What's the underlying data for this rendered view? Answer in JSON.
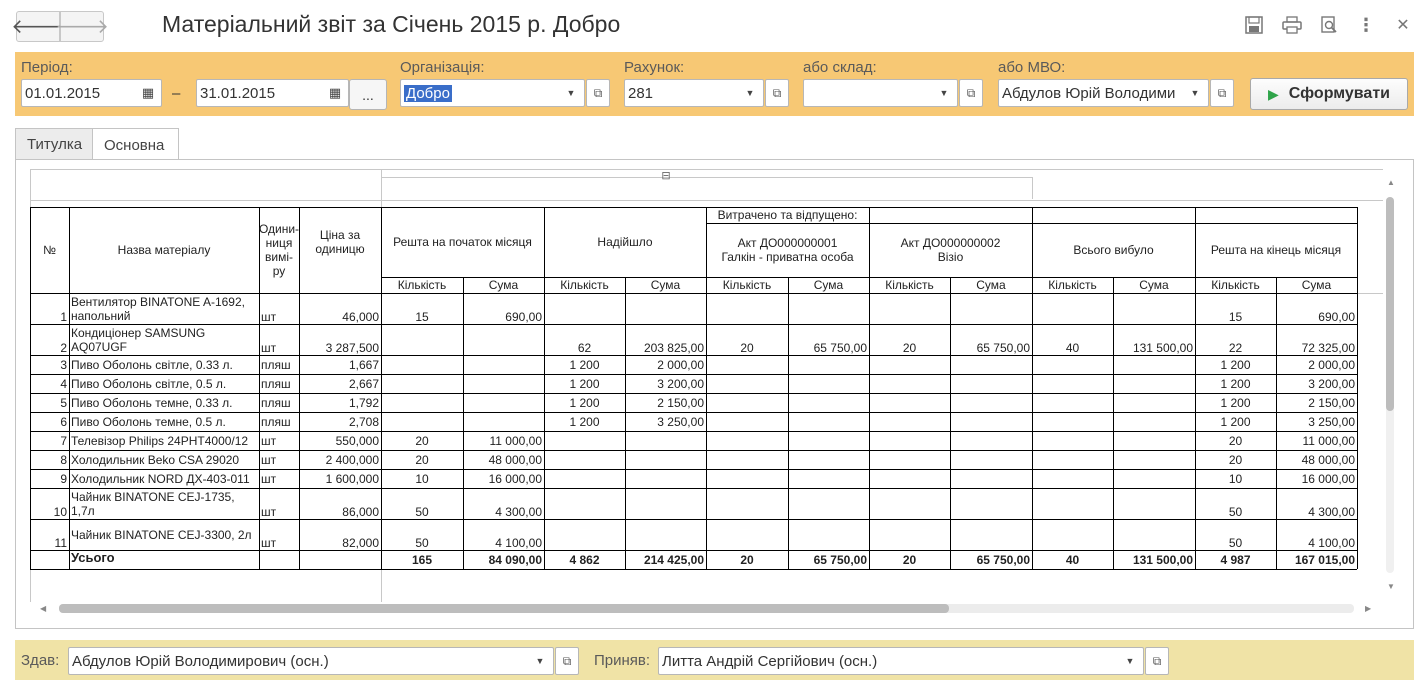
{
  "window": {
    "title": "Матеріальний звіт за Січень 2015 р. Добро"
  },
  "toolbar_icons": [
    "back-arrow",
    "forward-arrow",
    "save-icon",
    "print-icon",
    "preview-icon",
    "more-icon",
    "close-icon"
  ],
  "filters": {
    "period_label": "Період:",
    "date_from": "01.01.2015",
    "date_sep": "–",
    "date_to": "31.01.2015",
    "dots_label": "...",
    "org_label": "Організація:",
    "org_value": "Добро",
    "account_label": "Рахунок:",
    "account_value": "281",
    "warehouse_label": "або склад:",
    "warehouse_value": "",
    "mvo_label": "або МВО:",
    "mvo_value": "Абдулов Юрій Володими",
    "generate_label": "Сформувати"
  },
  "tabs": [
    {
      "label": "Титулка",
      "active": false
    },
    {
      "label": "Основна",
      "active": true
    }
  ],
  "report": {
    "headers": {
      "num": "№",
      "name": "Назва матеріалу",
      "unit": "Одини-\nниця\nвимі-\nру",
      "price": "Ціна за одиницю",
      "start": "Решта на початок місяця",
      "received": "Надійшло",
      "spent": "Витрачено та відпущено:",
      "act1": "Акт ДО000000001\nГалкін - приватна особа",
      "act2": "Акт ДО000000002\nВізіо",
      "total_out": "Всього вибуло",
      "end": "Решта на кінець місяця",
      "qty": "Кількість",
      "sum": "Сума"
    },
    "rows": [
      {
        "n": "1",
        "name": "Вентилятор BINATONE A-1692, напольний",
        "unit": "шт",
        "price": "46,000",
        "sq": "15",
        "ss": "690,00",
        "rq": "",
        "rs": "",
        "a1q": "",
        "a1s": "",
        "a2q": "",
        "a2s": "",
        "tq": "",
        "ts": "",
        "eq": "15",
        "es": "690,00"
      },
      {
        "n": "2",
        "name": "Кондиціонер SAMSUNG AQ07UGF",
        "unit": "шт",
        "price": "3 287,500",
        "sq": "",
        "ss": "",
        "rq": "62",
        "rs": "203 825,00",
        "a1q": "20",
        "a1s": "65 750,00",
        "a2q": "20",
        "a2s": "65 750,00",
        "tq": "40",
        "ts": "131 500,00",
        "eq": "22",
        "es": "72 325,00"
      },
      {
        "n": "3",
        "name": "Пиво Оболонь світле, 0.33 л.",
        "unit": "пляш",
        "price": "1,667",
        "sq": "",
        "ss": "",
        "rq": "1 200",
        "rs": "2 000,00",
        "a1q": "",
        "a1s": "",
        "a2q": "",
        "a2s": "",
        "tq": "",
        "ts": "",
        "eq": "1 200",
        "es": "2 000,00"
      },
      {
        "n": "4",
        "name": "Пиво Оболонь світле, 0.5 л.",
        "unit": "пляш",
        "price": "2,667",
        "sq": "",
        "ss": "",
        "rq": "1 200",
        "rs": "3 200,00",
        "a1q": "",
        "a1s": "",
        "a2q": "",
        "a2s": "",
        "tq": "",
        "ts": "",
        "eq": "1 200",
        "es": "3 200,00"
      },
      {
        "n": "5",
        "name": "Пиво Оболонь темне, 0.33 л.",
        "unit": "пляш",
        "price": "1,792",
        "sq": "",
        "ss": "",
        "rq": "1 200",
        "rs": "2 150,00",
        "a1q": "",
        "a1s": "",
        "a2q": "",
        "a2s": "",
        "tq": "",
        "ts": "",
        "eq": "1 200",
        "es": "2 150,00"
      },
      {
        "n": "6",
        "name": "Пиво Оболонь темне, 0.5 л.",
        "unit": "пляш",
        "price": "2,708",
        "sq": "",
        "ss": "",
        "rq": "1 200",
        "rs": "3 250,00",
        "a1q": "",
        "a1s": "",
        "a2q": "",
        "a2s": "",
        "tq": "",
        "ts": "",
        "eq": "1 200",
        "es": "3 250,00"
      },
      {
        "n": "7",
        "name": "Телевізор Philips 24PHT4000/12",
        "unit": "шт",
        "price": "550,000",
        "sq": "20",
        "ss": "11 000,00",
        "rq": "",
        "rs": "",
        "a1q": "",
        "a1s": "",
        "a2q": "",
        "a2s": "",
        "tq": "",
        "ts": "",
        "eq": "20",
        "es": "11 000,00"
      },
      {
        "n": "8",
        "name": "Холодильник Beko CSA 29020",
        "unit": "шт",
        "price": "2 400,000",
        "sq": "20",
        "ss": "48 000,00",
        "rq": "",
        "rs": "",
        "a1q": "",
        "a1s": "",
        "a2q": "",
        "a2s": "",
        "tq": "",
        "ts": "",
        "eq": "20",
        "es": "48 000,00"
      },
      {
        "n": "9",
        "name": "Холодильник NORD ДХ-403-011",
        "unit": "шт",
        "price": "1 600,000",
        "sq": "10",
        "ss": "16 000,00",
        "rq": "",
        "rs": "",
        "a1q": "",
        "a1s": "",
        "a2q": "",
        "a2s": "",
        "tq": "",
        "ts": "",
        "eq": "10",
        "es": "16 000,00"
      },
      {
        "n": "10",
        "name": "Чайник BINATONE CEJ-1735, 1,7л",
        "unit": "шт",
        "price": "86,000",
        "sq": "50",
        "ss": "4 300,00",
        "rq": "",
        "rs": "",
        "a1q": "",
        "a1s": "",
        "a2q": "",
        "a2s": "",
        "tq": "",
        "ts": "",
        "eq": "50",
        "es": "4 300,00"
      },
      {
        "n": "11",
        "name": "Чайник BINATONE CEJ-3300, 2л",
        "unit": "шт",
        "price": "82,000",
        "sq": "50",
        "ss": "4 100,00",
        "rq": "",
        "rs": "",
        "a1q": "",
        "a1s": "",
        "a2q": "",
        "a2s": "",
        "tq": "",
        "ts": "",
        "eq": "50",
        "es": "4 100,00"
      }
    ],
    "total": {
      "label": "Усього",
      "sq": "165",
      "ss": "84 090,00",
      "rq": "4 862",
      "rs": "214 425,00",
      "a1q": "20",
      "a1s": "65 750,00",
      "a2q": "20",
      "a2s": "65 750,00",
      "tq": "40",
      "ts": "131 500,00",
      "eq": "4 987",
      "es": "167 015,00"
    },
    "collapse_icon": "⊟"
  },
  "bottom": {
    "gave_label": "Здав:",
    "gave_value": "Абдулов Юрій Володимирович (осн.)",
    "received_label": "Приняв:",
    "received_value": "Литта Андрій Сергійович (осн.)"
  }
}
